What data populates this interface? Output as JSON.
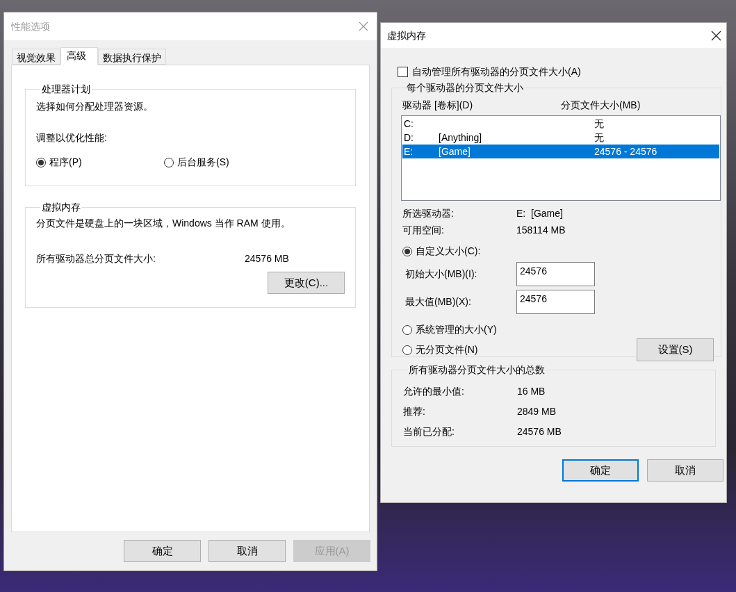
{
  "performance_options": {
    "title": "性能选项",
    "tabs": [
      {
        "label": "视觉效果",
        "selected": false
      },
      {
        "label": "高级",
        "selected": true
      },
      {
        "label": "数据执行保护",
        "selected": false
      }
    ],
    "processor_scheduling": {
      "title": "处理器计划",
      "description": "选择如何分配处理器资源。",
      "prompt": "调整以优化性能:",
      "options": [
        {
          "label": "程序(P)",
          "selected": true
        },
        {
          "label": "后台服务(S)",
          "selected": false
        }
      ]
    },
    "virtual_memory": {
      "title": "虚拟内存",
      "description": "分页文件是硬盘上的一块区域，Windows 当作 RAM 使用。",
      "total_label": "所有驱动器总分页文件大小:",
      "total_value": "24576 MB",
      "change_button": "更改(C)..."
    },
    "buttons": [
      {
        "label": "确定",
        "disabled": false
      },
      {
        "label": "取消",
        "disabled": false
      },
      {
        "label": "应用(A)",
        "disabled": true
      }
    ]
  },
  "virtual_memory_dialog": {
    "title": "虚拟内存",
    "auto_manage": {
      "label": "自动管理所有驱动器的分页文件大小(A)",
      "checked": false
    },
    "per_drive": {
      "title": "每个驱动器的分页文件大小",
      "columns": [
        "驱动器 [卷标](D)",
        "分页文件大小(MB)"
      ],
      "rows": [
        {
          "drive": "C:",
          "size": "无",
          "selected": false
        },
        {
          "drive": "D:",
          "volume": "[Anything]",
          "size": "无",
          "selected": false
        },
        {
          "drive": "E:",
          "volume": "[Game]",
          "size": "24576 - 24576",
          "selected": true
        }
      ],
      "info": [
        {
          "label": "所选驱动器:",
          "value": "E:  [Game]"
        },
        {
          "label": "可用空间:",
          "value": "158114 MB"
        }
      ],
      "size_options": [
        {
          "label": "自定义大小(C):",
          "selected": true
        },
        {
          "label": "系统管理的大小(Y)",
          "selected": false
        },
        {
          "label": "无分页文件(N)",
          "selected": false
        }
      ],
      "fields": [
        {
          "label": "初始大小(MB)(I):",
          "value": "24576"
        },
        {
          "label": "最大值(MB)(X):",
          "value": "24576"
        }
      ],
      "set_button": "设置(S)"
    },
    "totals": {
      "title": "所有驱动器分页文件大小的总数",
      "rows": [
        {
          "label": "允许的最小值:",
          "value": "16 MB"
        },
        {
          "label": "推荐:",
          "value": "2849 MB"
        },
        {
          "label": "当前已分配:",
          "value": "24576 MB"
        }
      ]
    },
    "buttons": [
      {
        "label": "确定",
        "default": true
      },
      {
        "label": "取消",
        "default": false
      }
    ]
  }
}
